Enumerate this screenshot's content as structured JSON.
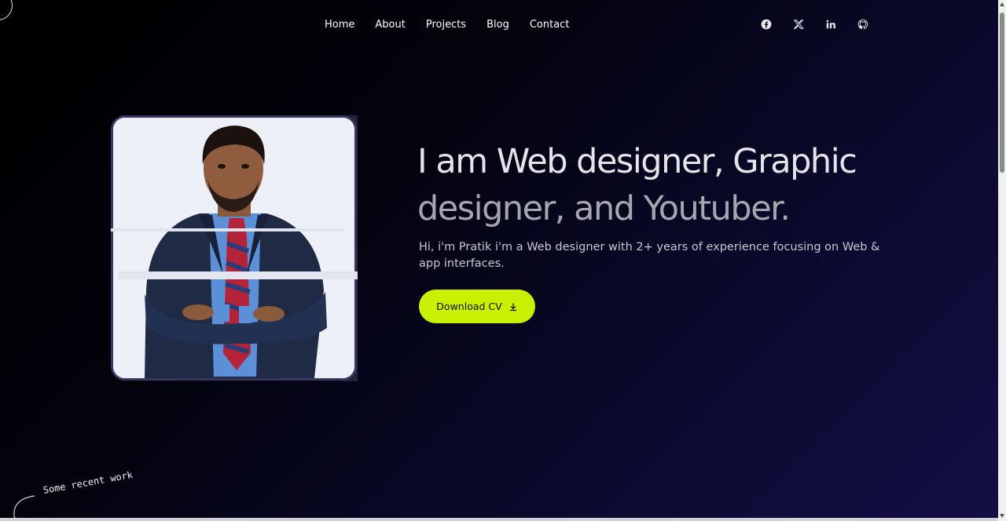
{
  "nav": {
    "items": [
      "Home",
      "About",
      "Projects",
      "Blog",
      "Contact"
    ]
  },
  "social": [
    {
      "icon": "facebook-icon"
    },
    {
      "icon": "x-twitter-icon"
    },
    {
      "icon": "linkedin-icon"
    },
    {
      "icon": "github-icon"
    }
  ],
  "hero": {
    "headline_line1": "I am Web designer, Graphic",
    "headline_line2": "designer, and Youtuber.",
    "intro": "Hi, i'm Pratik i'm a Web designer with 2+ years of experience focusing on Web & app interfaces.",
    "cta_label": "Download CV"
  },
  "recent_work_label": "Some recent work",
  "colors": {
    "accent": "#c8f000",
    "background_dark": "#000000",
    "background_end": "#130f45",
    "photo_border": "#3a3662"
  }
}
